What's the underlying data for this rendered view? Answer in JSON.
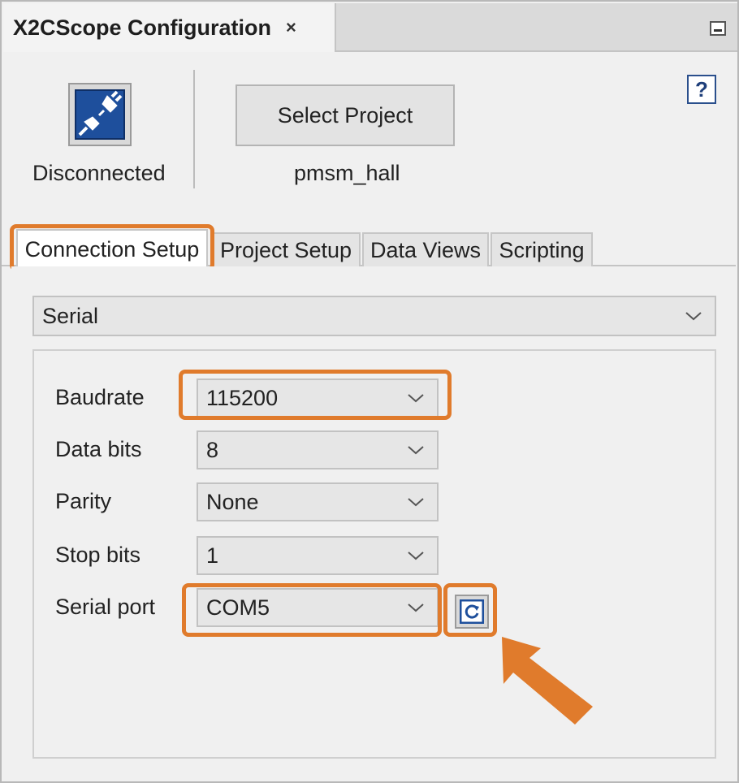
{
  "window": {
    "tab_title": "X2CScope Configuration",
    "close_glyph": "×"
  },
  "header": {
    "connection_status": "Disconnected",
    "select_project_label": "Select Project",
    "project_name": "pmsm_hall",
    "help_glyph": "?"
  },
  "tabs": [
    {
      "label": "Connection Setup",
      "active": true
    },
    {
      "label": "Project Setup",
      "active": false
    },
    {
      "label": "Data Views",
      "active": false
    },
    {
      "label": "Scripting",
      "active": false
    }
  ],
  "connection": {
    "interface": "Serial",
    "fields": [
      {
        "label": "Baudrate",
        "value": "115200"
      },
      {
        "label": "Data bits",
        "value": "8"
      },
      {
        "label": "Parity",
        "value": "None"
      },
      {
        "label": "Stop bits",
        "value": "1"
      },
      {
        "label": "Serial port",
        "value": "COM5"
      }
    ]
  },
  "colors": {
    "highlight": "#e07b2c",
    "icon_blue": "#1e4f9c"
  },
  "icons": {
    "connect": "plug-disconnected-icon",
    "refresh": "refresh-icon",
    "help": "help-icon"
  }
}
